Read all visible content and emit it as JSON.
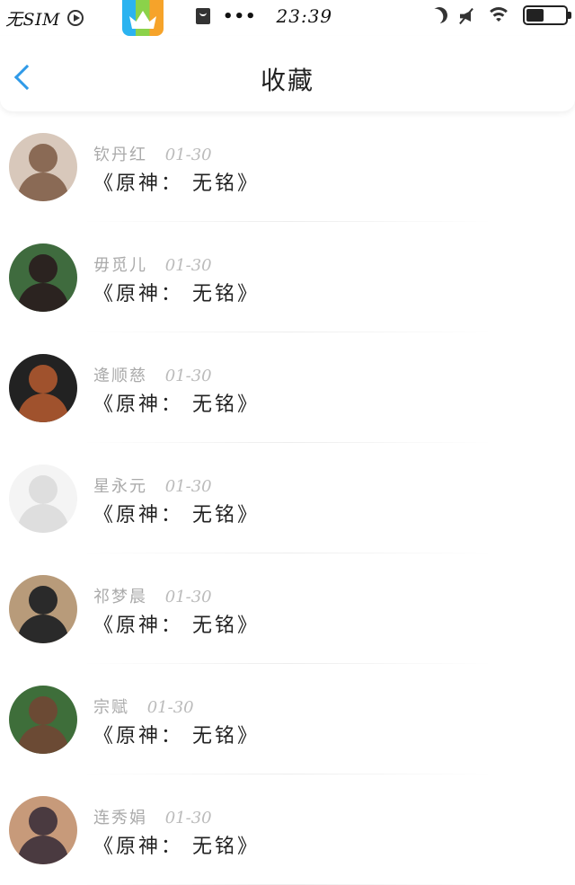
{
  "status_bar": {
    "carrier": "无SIM",
    "time": "23:39",
    "dots": "•••",
    "battery_level": 0.45,
    "icons": [
      "play-circle-icon",
      "app-store-icon",
      "bag-icon",
      "moon-icon",
      "mute-icon",
      "wifi-icon",
      "battery-icon"
    ]
  },
  "nav": {
    "title": "收藏",
    "back_icon": "chevron-left-icon",
    "accent": "#2f9ae8"
  },
  "favorites": [
    {
      "name": "钦丹红",
      "date": "01-30",
      "content": "《原神： 无铭》",
      "avatar_colors": [
        "#8a6a55",
        "#d8c8bb"
      ]
    },
    {
      "name": "毋觅儿",
      "date": "01-30",
      "content": "《原神： 无铭》",
      "avatar_colors": [
        "#2b2320",
        "#3f6b3e"
      ]
    },
    {
      "name": "逄顺慈",
      "date": "01-30",
      "content": "《原神： 无铭》",
      "avatar_colors": [
        "#a0522d",
        "#222222"
      ]
    },
    {
      "name": "星永元",
      "date": "01-30",
      "content": "《原神： 无铭》",
      "avatar_colors": [
        "#dedede",
        "#f4f4f4"
      ]
    },
    {
      "name": "祁梦晨",
      "date": "01-30",
      "content": "《原神： 无铭》",
      "avatar_colors": [
        "#2a2a2a",
        "#b89b7a"
      ]
    },
    {
      "name": "宗赋",
      "date": "01-30",
      "content": "《原神： 无铭》",
      "avatar_colors": [
        "#6b4a34",
        "#3e6e3a"
      ]
    },
    {
      "name": "连秀娟",
      "date": "01-30",
      "content": "《原神： 无铭》",
      "avatar_colors": [
        "#4a3a40",
        "#c79a7a"
      ]
    }
  ]
}
